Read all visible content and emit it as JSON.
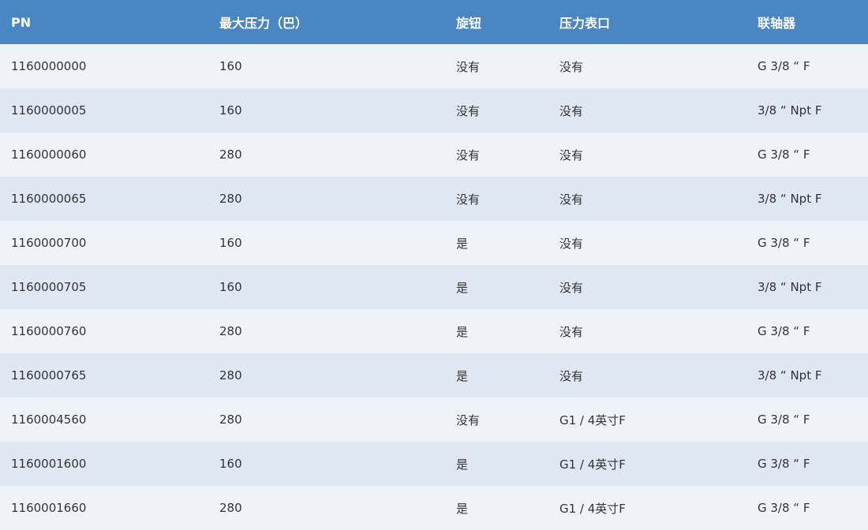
{
  "table": {
    "headers": [
      "PN",
      "最大压力（巴）",
      "旋钮",
      "压力表口",
      "联轴器"
    ],
    "rows": [
      [
        "1160000000",
        "160",
        "没有",
        "没有",
        "G 3/8 “ F"
      ],
      [
        "1160000005",
        "160",
        "没有",
        "没有",
        "3/8 “ Npt F"
      ],
      [
        "1160000060",
        "280",
        "没有",
        "没有",
        "G 3/8 “ F"
      ],
      [
        "1160000065",
        "280",
        "没有",
        "没有",
        "3/8 “ Npt F"
      ],
      [
        "1160000700",
        "160",
        "是",
        "没有",
        "G 3/8 “ F"
      ],
      [
        "1160000705",
        "160",
        "是",
        "没有",
        "3/8 “ Npt F"
      ],
      [
        "1160000760",
        "280",
        "是",
        "没有",
        "G 3/8 “ F"
      ],
      [
        "1160000765",
        "280",
        "是",
        "没有",
        "3/8 “ Npt F"
      ],
      [
        "1160004560",
        "280",
        "没有",
        "G1 / 4英寸F",
        "G 3/8 “ F"
      ],
      [
        "1160001600",
        "160",
        "是",
        "G1 / 4英寸F",
        "G 3/8 “ F"
      ],
      [
        "1160001660",
        "280",
        "是",
        "G1 / 4英寸F",
        "G 3/8 “ F"
      ]
    ]
  },
  "colors": {
    "header_background": "#4a86c2",
    "row_odd": "#eff3f9",
    "row_even": "#dfe7f2"
  }
}
